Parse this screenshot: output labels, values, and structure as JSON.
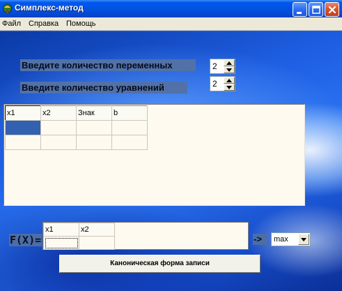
{
  "window": {
    "title": "Симплекс-метод",
    "controls": {
      "minimize": "minimize-icon",
      "maximize": "maximize-icon",
      "close": "close-icon"
    }
  },
  "menu": {
    "items": [
      {
        "label": "Файл"
      },
      {
        "label": "Справка"
      },
      {
        "label": "Помощь"
      }
    ]
  },
  "form": {
    "variables_label": "Введите количество  переменных",
    "variables_value": "2",
    "equations_label": "Введите количество уравнений",
    "equations_value": "2"
  },
  "constraints_table": {
    "headers": [
      "x1",
      "x2",
      "Знак",
      "b"
    ],
    "rows": [
      [
        "",
        "",
        "",
        ""
      ],
      [
        "",
        "",
        "",
        ""
      ]
    ]
  },
  "objective": {
    "label": "F(X)=",
    "headers": [
      "x1",
      "x2"
    ],
    "values": [
      "",
      ""
    ],
    "arrow_label": "->",
    "direction": "max"
  },
  "actions": {
    "canonical_form_button": "Каноническая форма записи"
  },
  "colors": {
    "titlebar": "#0058ee",
    "label_bg": "#5171a8",
    "selected_cell": "#3161b0",
    "grid_bg": "#fffaf0"
  }
}
